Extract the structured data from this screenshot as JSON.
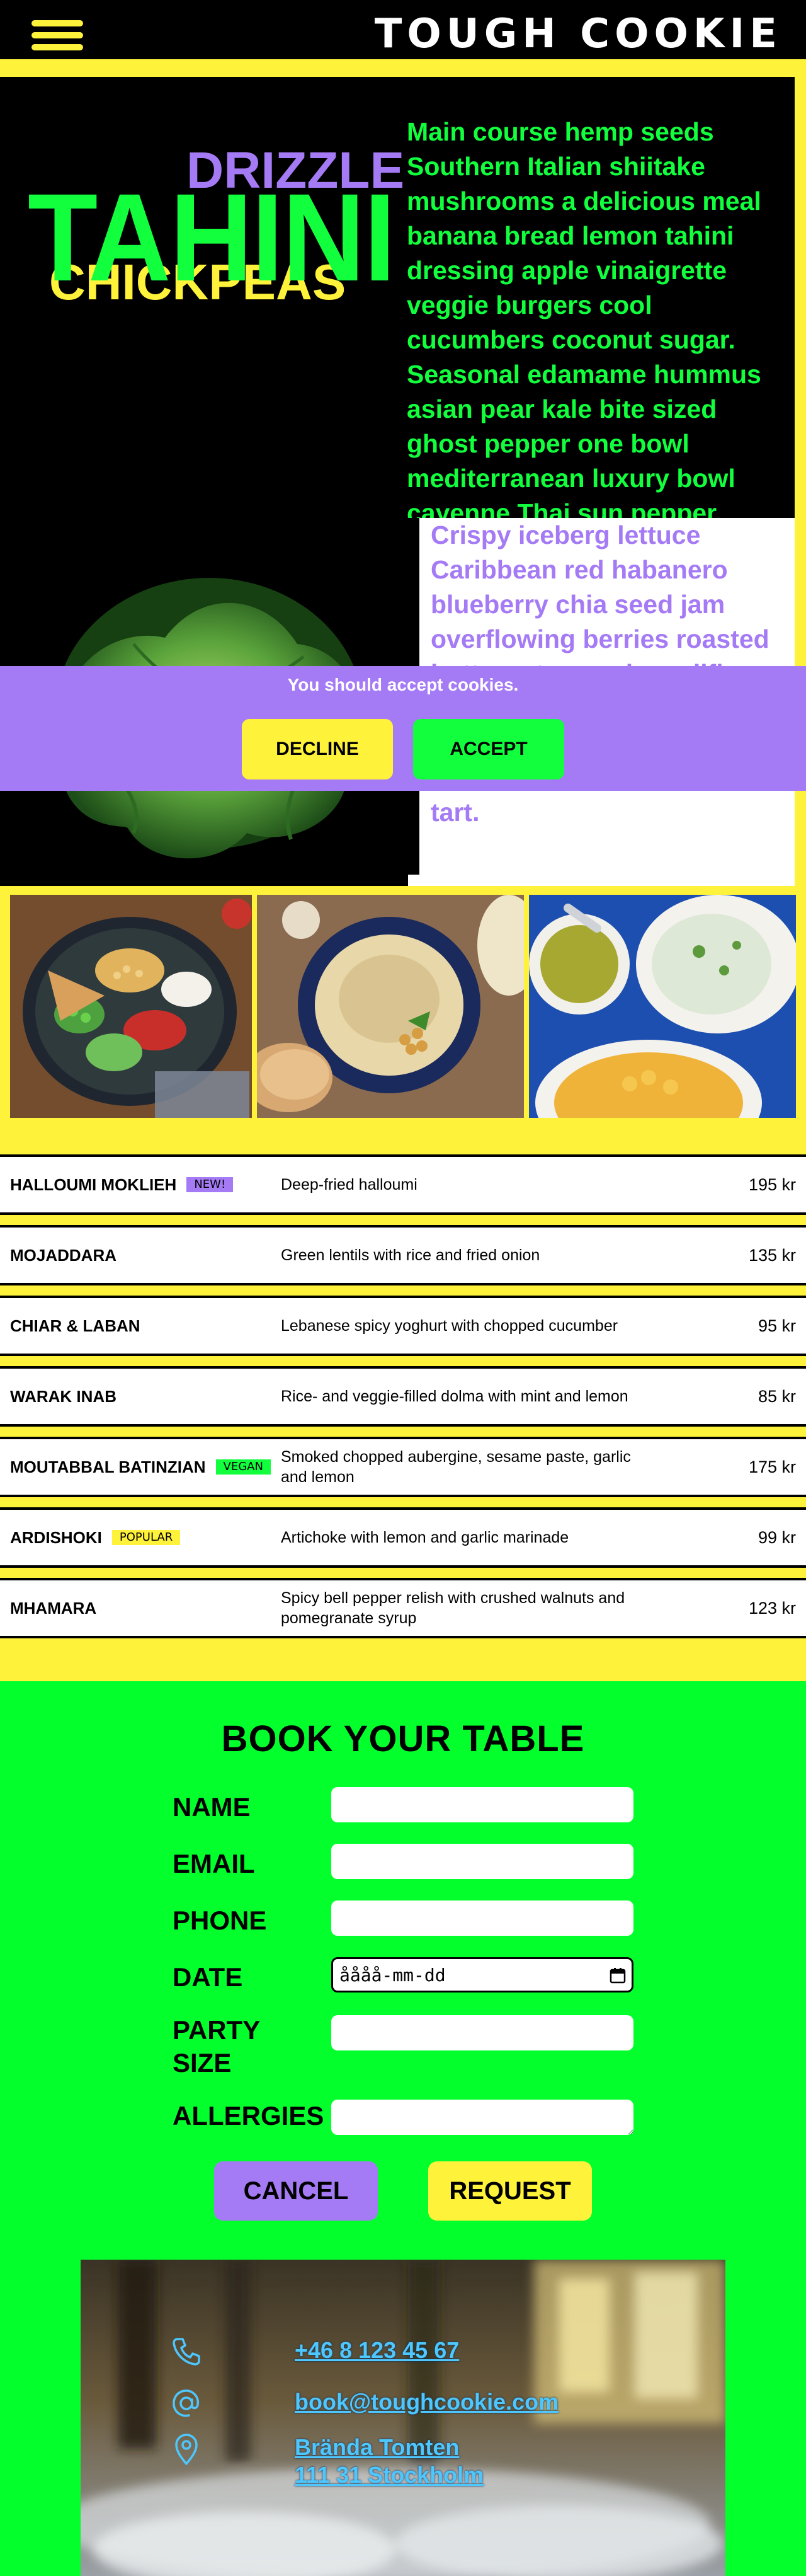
{
  "header": {
    "brand": "TOUGH COOKIE",
    "menu_icon": "hamburger-icon"
  },
  "hero": {
    "word_top": "DRIZZLE",
    "word_main": "TAHINI",
    "word_bottom": "CHICKPEAS",
    "intro": "Main course hemp seeds Southern Italian shiitake mushrooms a delicious meal banana bread lemon tahini dressing apple vinaigrette veggie burgers cool cucumbers coconut sugar. Seasonal edamame hummus asian pear kale bite sized ghost pepper one bowl mediterranean luxury bowl cayenne Thai sun pepper.",
    "card_text": "Crispy iceberg lettuce Caribbean red habanero blueberry chia seed jam overflowing berries roasted butternut squash cauliflower ginger sweet potato chocolate cookie seeds samosa walnut mushroom tart."
  },
  "cookie_banner": {
    "message": "You should accept cookies.",
    "decline_label": "DECLINE",
    "accept_label": "ACCEPT"
  },
  "menu": {
    "items": [
      {
        "name": "HALLOUMI MOKLIEH",
        "badge": "NEW!",
        "badge_color": "#a57bf5",
        "description": "Deep-fried halloumi",
        "price": "195 kr"
      },
      {
        "name": "MOJADDARA",
        "badge": "",
        "badge_color": "",
        "description": "Green lentils with rice and fried onion",
        "price": "135 kr"
      },
      {
        "name": "CHIAR & LABAN",
        "badge": "",
        "badge_color": "",
        "description": "Lebanese spicy yoghurt with chopped cucumber",
        "price": "95 kr"
      },
      {
        "name": "WARAK INAB",
        "badge": "",
        "badge_color": "",
        "description": "Rice- and veggie-filled dolma with mint and lemon",
        "price": "85 kr"
      },
      {
        "name": "MOUTABBAL BATINZIAN",
        "badge": "VEGAN",
        "badge_color": "#11ff3d",
        "description": "Smoked chopped aubergine, sesame paste, garlic and lemon",
        "price": "175 kr"
      },
      {
        "name": "ARDISHOKI",
        "badge": "POPULAR",
        "badge_color": "#fff23a",
        "description": "Artichoke with lemon and garlic marinade",
        "price": "99 kr"
      },
      {
        "name": "MHAMARA",
        "badge": "",
        "badge_color": "",
        "description": "Spicy bell pepper relish with crushed walnuts and pomegranate syrup",
        "price": "123 kr"
      }
    ]
  },
  "booking": {
    "title": "BOOK YOUR TABLE",
    "fields": {
      "name_label": "NAME",
      "email_label": "EMAIL",
      "phone_label": "PHONE",
      "date_label": "DATE",
      "date_value": "åååå-mm-dd",
      "party_label": "PARTY SIZE",
      "allergies_label": "ALLERGIES"
    },
    "cancel_label": "CANCEL",
    "request_label": "REQUEST"
  },
  "contact": {
    "phone": "+46 8 123 45 67",
    "email": "book@toughcookie.com",
    "address_line1": "Brända Tomten",
    "address_line2": "111 31 Stockholm"
  },
  "colors": {
    "black": "#000000",
    "yellow": "#fff23a",
    "green": "#11ff3d",
    "purple": "#a57bf5",
    "link_blue": "#4ec7ff"
  }
}
